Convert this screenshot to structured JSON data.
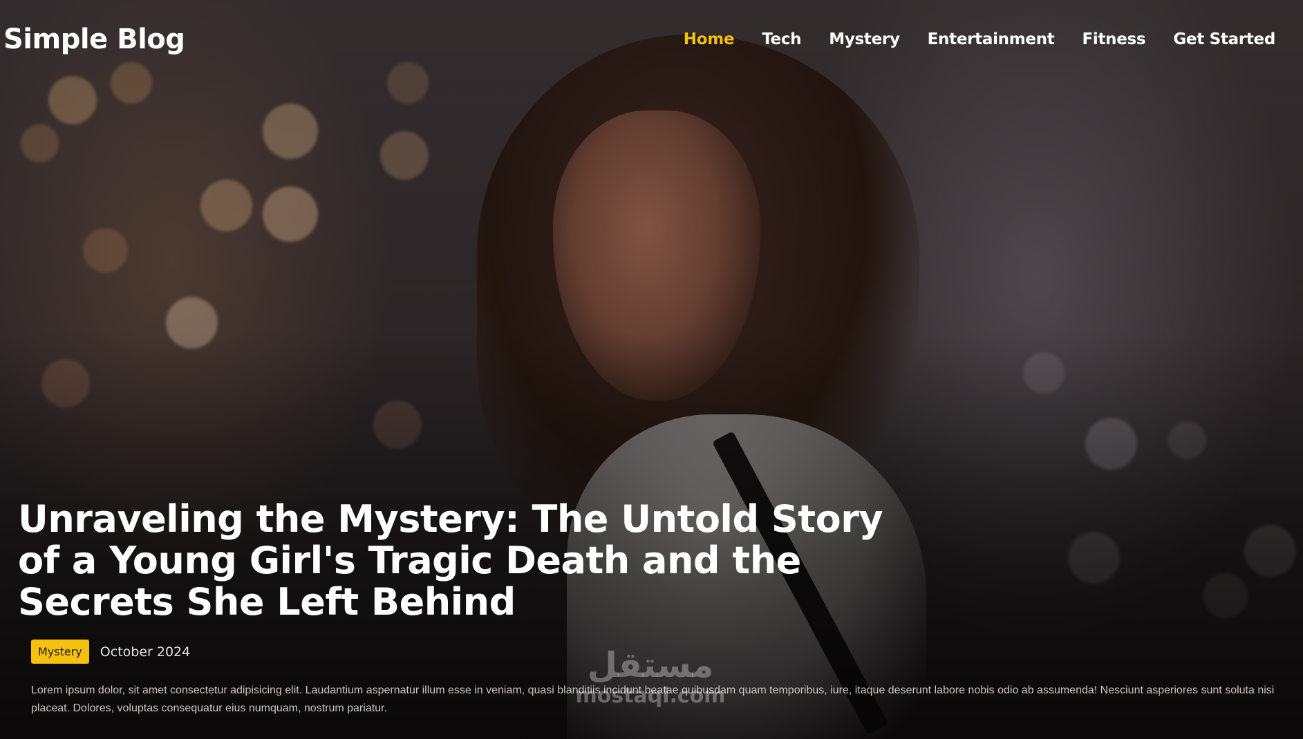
{
  "header": {
    "brand": "Simple Blog",
    "nav": [
      {
        "label": "Home",
        "active": true
      },
      {
        "label": "Tech",
        "active": false
      },
      {
        "label": "Mystery",
        "active": false
      },
      {
        "label": "Entertainment",
        "active": false
      },
      {
        "label": "Fitness",
        "active": false
      },
      {
        "label": "Get Started",
        "active": false
      }
    ]
  },
  "hero": {
    "image_subject": "woman looking over shoulder with bokeh city lights background"
  },
  "article": {
    "title": "Unraveling the Mystery: The Untold Story of a Young Girl's Tragic Death and the Secrets She Left Behind",
    "category": "Mystery",
    "date": "October 2024",
    "excerpt": "Lorem ipsum dolor, sit amet consectetur adipisicing elit. Laudantium aspernatur illum esse in veniam, quasi blanditiis incidunt beatae quibusdam quam temporibus, iure, itaque deserunt labore nobis odio ab assumenda! Nesciunt asperiores sunt soluta nisi placeat. Dolores, voluptas consequatur eius numquam, nostrum pariatur."
  },
  "watermark": {
    "arabic": "مستقل",
    "latin": "mostaql.com"
  },
  "colors": {
    "accent": "#f4c20d",
    "text": "#ffffff"
  }
}
